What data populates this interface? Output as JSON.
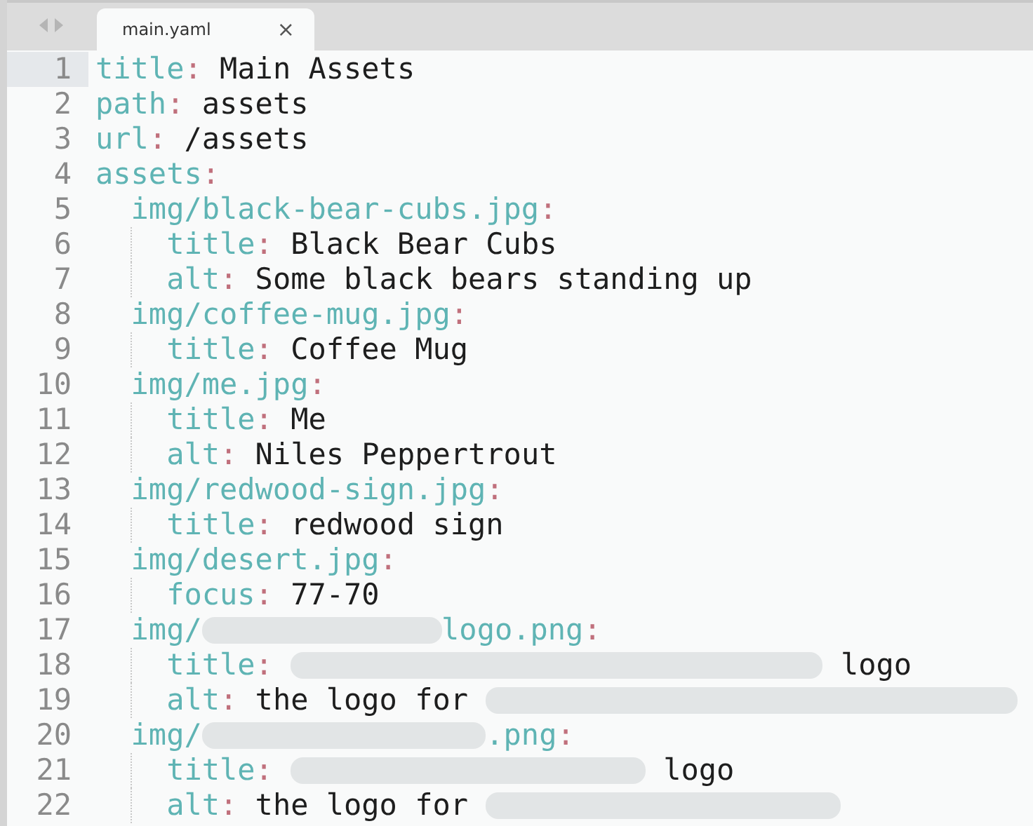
{
  "tab": {
    "title": "main.yaml",
    "close": "×",
    "selected": true
  },
  "lines": [
    {
      "number": "1",
      "selected": true,
      "tokens": [
        {
          "kind": "key",
          "text": "title"
        },
        {
          "kind": "punct",
          "text": ":"
        },
        {
          "kind": "value",
          "text": "Main Assets"
        }
      ]
    },
    {
      "number": "2",
      "selected": false,
      "tokens": [
        {
          "kind": "key",
          "text": "path"
        },
        {
          "kind": "punct",
          "text": ":"
        },
        {
          "kind": "value",
          "text": "assets"
        }
      ]
    },
    {
      "number": "3",
      "selected": false,
      "tokens": [
        {
          "kind": "key",
          "text": "url"
        },
        {
          "kind": "punct",
          "text": ":"
        },
        {
          "kind": "value",
          "text": "/assets"
        }
      ]
    },
    {
      "number": "4",
      "selected": false,
      "tokens": [
        {
          "kind": "key",
          "text": "assets"
        },
        {
          "kind": "punct",
          "text": ":"
        }
      ],
      "children": [
        {
          "number": "5",
          "selected": false,
          "tokens": [
            {
              "kind": "key",
              "text": "img/black-bear-cubs.jpg"
            },
            {
              "kind": "punct",
              "text": ":"
            }
          ],
          "children": [
            {
              "number": "6",
              "selected": false,
              "tokens": [
                {
                  "kind": "key",
                  "text": "title"
                },
                {
                  "kind": "punct",
                  "text": ":"
                },
                {
                  "kind": "value",
                  "text": "Black Bear Cubs"
                }
              ]
            },
            {
              "number": "7",
              "selected": false,
              "tokens": [
                {
                  "kind": "key",
                  "text": "alt"
                },
                {
                  "kind": "punct",
                  "text": ":"
                },
                {
                  "kind": "value",
                  "text": "Some black bears standing up"
                }
              ]
            }
          ]
        },
        {
          "number": "8",
          "selected": false,
          "tokens": [
            {
              "kind": "key",
              "text": "img/coffee-mug.jpg"
            },
            {
              "kind": "punct",
              "text": ":"
            }
          ],
          "children": [
            {
              "number": "9",
              "selected": false,
              "tokens": [
                {
                  "kind": "key",
                  "text": "title"
                },
                {
                  "kind": "punct",
                  "text": ":"
                },
                {
                  "kind": "value",
                  "text": "Coffee Mug"
                }
              ]
            }
          ]
        },
        {
          "number": "10",
          "selected": false,
          "tokens": [
            {
              "kind": "key",
              "text": "img/me.jpg"
            },
            {
              "kind": "punct",
              "text": ":"
            }
          ],
          "children": [
            {
              "number": "11",
              "selected": false,
              "tokens": [
                {
                  "kind": "key",
                  "text": "title"
                },
                {
                  "kind": "punct",
                  "text": ":"
                },
                {
                  "kind": "value",
                  "text": "Me"
                }
              ]
            },
            {
              "number": "12",
              "selected": false,
              "tokens": [
                {
                  "kind": "key",
                  "text": "alt"
                },
                {
                  "kind": "punct",
                  "text": ":"
                },
                {
                  "kind": "value",
                  "text": "Niles Peppertrout"
                }
              ]
            }
          ]
        },
        {
          "number": "13",
          "selected": false,
          "tokens": [
            {
              "kind": "key",
              "text": "img/redwood-sign.jpg"
            },
            {
              "kind": "punct",
              "text": ":"
            }
          ],
          "children": [
            {
              "number": "14",
              "selected": false,
              "tokens": [
                {
                  "kind": "key",
                  "text": "title"
                },
                {
                  "kind": "punct",
                  "text": ":"
                },
                {
                  "kind": "value",
                  "text": "redwood sign"
                }
              ]
            }
          ]
        },
        {
          "number": "15",
          "selected": false,
          "tokens": [
            {
              "kind": "key",
              "text": "img/desert.jpg"
            },
            {
              "kind": "punct",
              "text": ":"
            }
          ],
          "children": [
            {
              "number": "16",
              "selected": false,
              "tokens": [
                {
                  "kind": "key",
                  "text": "focus"
                },
                {
                  "kind": "punct",
                  "text": ":"
                },
                {
                  "kind": "value",
                  "text": "77-70"
                }
              ]
            }
          ]
        },
        {
          "number": "17",
          "selected": false,
          "tokens": [
            {
              "kind": "key",
              "text": "img/"
            },
            {
              "kind": "redacted"
            },
            {
              "kind": "key",
              "text": "logo.png"
            },
            {
              "kind": "punct",
              "text": ":"
            }
          ],
          "children": [
            {
              "number": "18",
              "selected": false,
              "tokens": [
                {
                  "kind": "key",
                  "text": "title"
                },
                {
                  "kind": "punct",
                  "text": ":"
                },
                {
                  "kind": "redacted"
                },
                {
                  "kind": "value",
                  "text": "logo"
                }
              ]
            },
            {
              "number": "19",
              "selected": false,
              "tokens": [
                {
                  "kind": "key",
                  "text": "alt"
                },
                {
                  "kind": "punct",
                  "text": ":"
                },
                {
                  "kind": "value",
                  "text": "the logo for"
                },
                {
                  "kind": "redacted"
                }
              ]
            }
          ]
        },
        {
          "number": "20",
          "selected": false,
          "tokens": [
            {
              "kind": "key",
              "text": "img/"
            },
            {
              "kind": "redacted"
            },
            {
              "kind": "key",
              "text": ".png"
            },
            {
              "kind": "punct",
              "text": ":"
            }
          ],
          "children": [
            {
              "number": "21",
              "selected": false,
              "tokens": [
                {
                  "kind": "key",
                  "text": "title"
                },
                {
                  "kind": "punct",
                  "text": ":"
                },
                {
                  "kind": "redacted"
                },
                {
                  "kind": "value",
                  "text": "logo"
                }
              ]
            },
            {
              "number": "22",
              "selected": false,
              "tokens": [
                {
                  "kind": "key",
                  "text": "alt"
                },
                {
                  "kind": "punct",
                  "text": ":"
                },
                {
                  "kind": "value",
                  "text": "the logo for"
                },
                {
                  "kind": "redacted"
                }
              ]
            }
          ]
        }
      ]
    }
  ]
}
